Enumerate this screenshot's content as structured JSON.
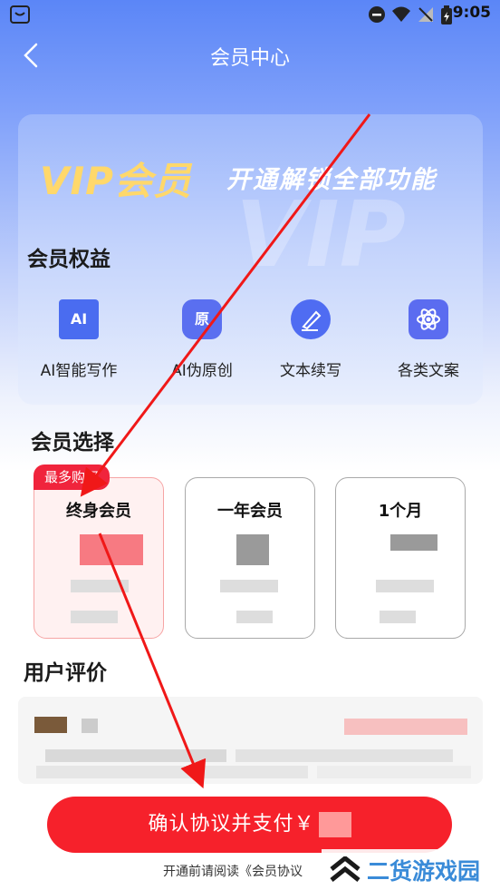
{
  "status_bar": {
    "time": "9:05"
  },
  "header": {
    "back_icon": "chevron-left-icon",
    "title": "会员中心"
  },
  "vip_card": {
    "title": "VIP会员",
    "slogan": "开通解锁全部功能",
    "watermark": "VIP"
  },
  "benefits": {
    "title": "会员权益",
    "items": [
      {
        "label": "AI智能写作",
        "icon": "AI"
      },
      {
        "label": "AI伪原创",
        "icon": "原"
      },
      {
        "label": "文本续写",
        "icon": "pen-icon"
      },
      {
        "label": "各类文案",
        "icon": "atom-icon"
      }
    ]
  },
  "plans": {
    "title": "会员选择",
    "badge": "最多购买",
    "items": [
      {
        "name": "终身会员",
        "selected": true
      },
      {
        "name": "一年会员",
        "selected": false
      },
      {
        "name": "1个月",
        "selected": false
      }
    ]
  },
  "reviews": {
    "title": "用户评价"
  },
  "pay": {
    "button": "确认协议并支付￥",
    "agreement": "开通前请阅读《会员协议"
  },
  "site_watermark": "二货游戏园",
  "colors": {
    "accent": "#f6212b",
    "brand_blue": "#5b86f7",
    "vip_gold": "#ffd86b"
  }
}
